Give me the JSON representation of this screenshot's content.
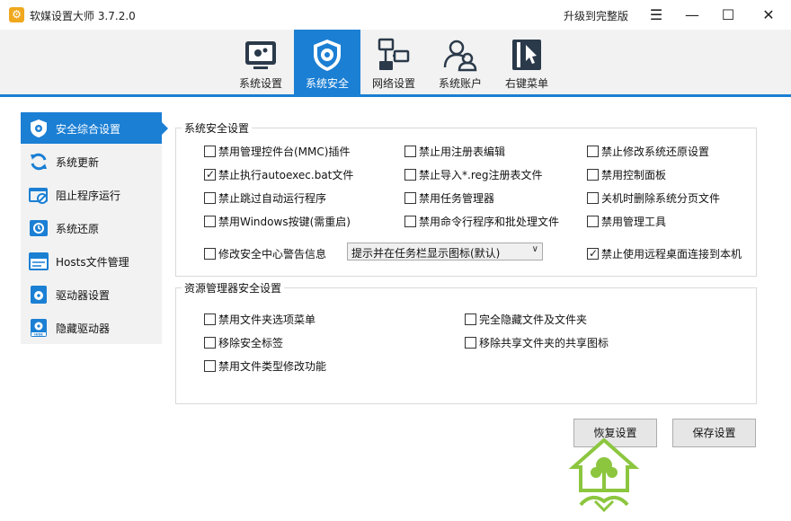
{
  "window": {
    "title": "软媒设置大师 3.7.2.0",
    "app_icon_glyph": "⚙",
    "upgrade_label": "升级到完整版",
    "menu_glyph": "☰",
    "minimize_glyph": "—",
    "maximize_glyph": "☐",
    "close_glyph": "✕"
  },
  "toolbar": {
    "tabs": [
      {
        "label": "系统设置",
        "icon": "gear-monitor-icon"
      },
      {
        "label": "系统安全",
        "icon": "shield-gear-icon",
        "active": true
      },
      {
        "label": "网络设置",
        "icon": "network-icon"
      },
      {
        "label": "系统账户",
        "icon": "users-icon"
      },
      {
        "label": "右键菜单",
        "icon": "cursor-menu-icon"
      }
    ]
  },
  "sidebar": {
    "items": [
      {
        "label": "安全综合设置",
        "icon": "shield-icon",
        "active": true
      },
      {
        "label": "系统更新",
        "icon": "refresh-icon"
      },
      {
        "label": "阻止程序运行",
        "icon": "block-program-icon"
      },
      {
        "label": "系统还原",
        "icon": "restore-icon"
      },
      {
        "label": "Hosts文件管理",
        "icon": "hosts-file-icon"
      },
      {
        "label": "驱动器设置",
        "icon": "drive-icon"
      },
      {
        "label": "隐藏驱动器",
        "icon": "hide-drive-icon",
        "badge": "HIDE"
      }
    ]
  },
  "security_group": {
    "title": "系统安全设置",
    "options": [
      {
        "label": "禁用管理控件台(MMC)插件",
        "checked": false
      },
      {
        "label": "禁止用注册表编辑",
        "checked": false
      },
      {
        "label": "禁止修改系统还原设置",
        "checked": false
      },
      {
        "label": "禁止执行autoexec.bat文件",
        "checked": true
      },
      {
        "label": "禁止导入*.reg注册表文件",
        "checked": false
      },
      {
        "label": "禁用控制面板",
        "checked": false
      },
      {
        "label": "禁止跳过自动运行程序",
        "checked": false
      },
      {
        "label": "禁用任务管理器",
        "checked": false
      },
      {
        "label": "关机时删除系统分页文件",
        "checked": false
      },
      {
        "label": "禁用Windows按键(需重启)",
        "checked": false
      },
      {
        "label": "禁用命令行程序和批处理文件",
        "checked": false
      },
      {
        "label": "禁用管理工具",
        "checked": false
      },
      {
        "label": "修改安全中心警告信息",
        "checked": false
      },
      {
        "label": "禁止使用远程桌面连接到本机",
        "checked": true
      }
    ],
    "alert_select_value": "提示并在任务栏显示图标(默认)"
  },
  "explorer_group": {
    "title": "资源管理器安全设置",
    "options": [
      {
        "label": "禁用文件夹选项菜单",
        "checked": false
      },
      {
        "label": "完全隐藏文件及文件夹",
        "checked": false
      },
      {
        "label": "移除安全标签",
        "checked": false
      },
      {
        "label": "移除共享文件夹的共享图标",
        "checked": false
      },
      {
        "label": "禁用文件类型修改功能",
        "checked": false
      }
    ]
  },
  "buttons": {
    "restore": "恢复设置",
    "save": "保存设置"
  },
  "check_glyph": "✓",
  "colors": {
    "accent": "#1b7fd4",
    "icon_dark": "#2b3a4a"
  }
}
